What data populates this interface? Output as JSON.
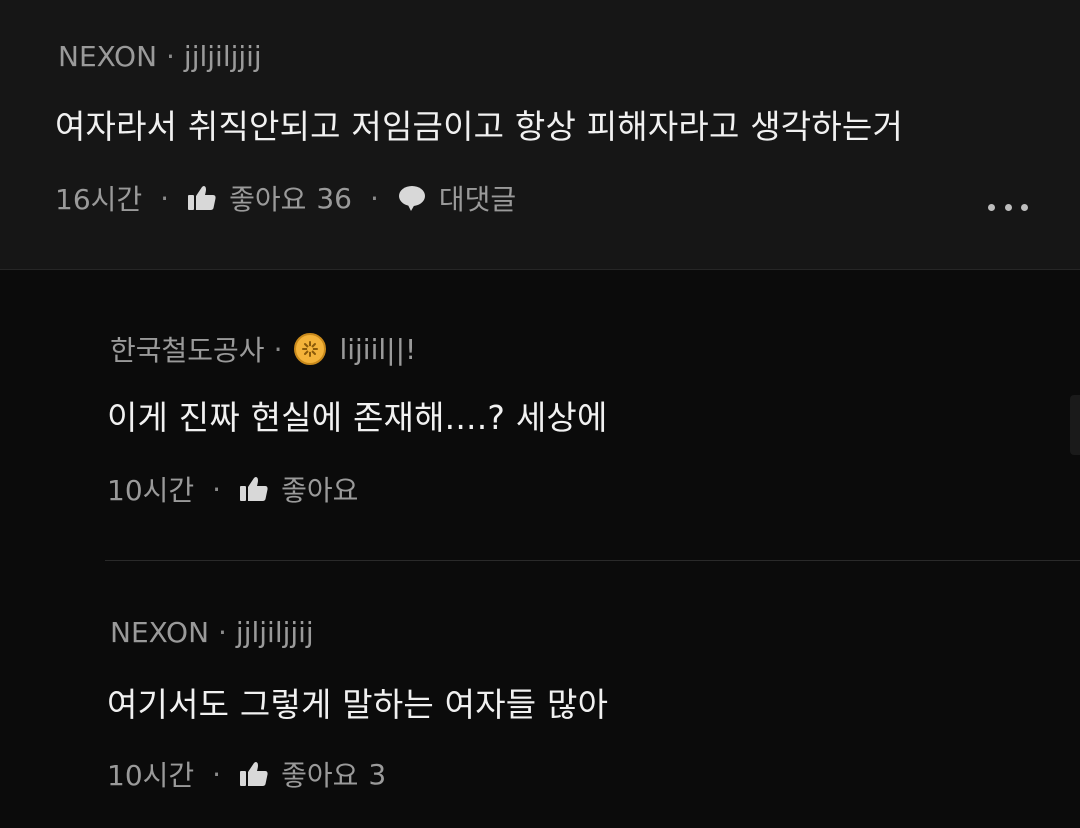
{
  "comments": [
    {
      "author": "NEXON",
      "username": "jjljiljjij",
      "text": "여자라서 취직안되고 저임금이고 항상 피해자라고 생각하는거",
      "time": "16시간",
      "like_label": "좋아요",
      "like_count": "36",
      "reply_label": "대댓글"
    },
    {
      "author": "한국철도공사",
      "badge_icon": "gold-sun-badge-icon",
      "username": "lijiil||!",
      "text": "이게 진짜 현실에 존재해....? 세상에",
      "time": "10시간",
      "like_label": "좋아요",
      "like_count": ""
    },
    {
      "author": "NEXON",
      "username": "jjljiljjij",
      "text": "여기서도 그렇게 말하는 여자들 많아",
      "time": "10시간",
      "like_label": "좋아요",
      "like_count": "3"
    }
  ],
  "separator_dot": "·",
  "colors": {
    "background": "#0b0b0b",
    "top_comment_bg": "#161616",
    "text": "#f1f1f1",
    "meta_text": "#9a9a9a",
    "badge": "#f4b33a"
  }
}
